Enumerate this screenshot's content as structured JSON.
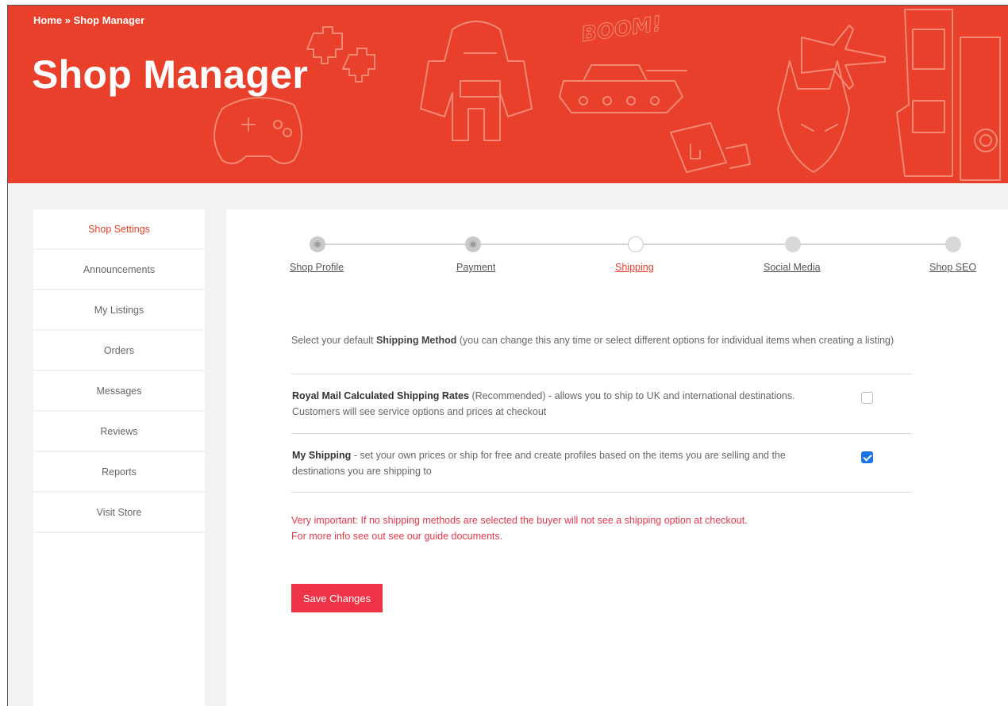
{
  "header": {
    "breadcrumb_home": "Home",
    "breadcrumb_sep": "»",
    "breadcrumb_current": "Shop Manager",
    "title": "Shop Manager",
    "doodle_text": "BOOM!"
  },
  "sidebar": {
    "items": [
      {
        "label": "Shop Settings",
        "active": true
      },
      {
        "label": "Announcements"
      },
      {
        "label": "My Listings"
      },
      {
        "label": "Orders"
      },
      {
        "label": "Messages"
      },
      {
        "label": "Reviews"
      },
      {
        "label": "Reports"
      },
      {
        "label": "Visit Store"
      }
    ]
  },
  "stepper": {
    "steps": [
      {
        "label": "Shop Profile",
        "state": "done"
      },
      {
        "label": "Payment",
        "state": "done"
      },
      {
        "label": "Shipping",
        "state": "current"
      },
      {
        "label": "Social Media",
        "state": "todo"
      },
      {
        "label": "Shop SEO",
        "state": "todo"
      }
    ]
  },
  "shipping": {
    "intro_pre": "Select your default ",
    "intro_bold": "Shipping Method",
    "intro_post": " (you can change this any time or select different options for individual items when creating a listing)",
    "options": [
      {
        "title": "Royal Mail Calculated Shipping Rates",
        "description": " (Recommended) - allows you to ship to UK and international destinations. Customers will see service options and prices at checkout",
        "checked": false
      },
      {
        "title": "My Shipping",
        "description": " - set your own prices or ship for free and create profiles based on the items you are selling and the destinations you are shipping to",
        "checked": true
      }
    ],
    "warning_line1": "Very important: If no shipping methods are selected the buyer will not see a shipping option at checkout.",
    "warning_line2": "For more info see out see our guide documents."
  },
  "actions": {
    "save_label": "Save Changes"
  },
  "colors": {
    "brand": "#e8402a",
    "button": "#ee3346",
    "checkbox": "#1a73e8"
  }
}
